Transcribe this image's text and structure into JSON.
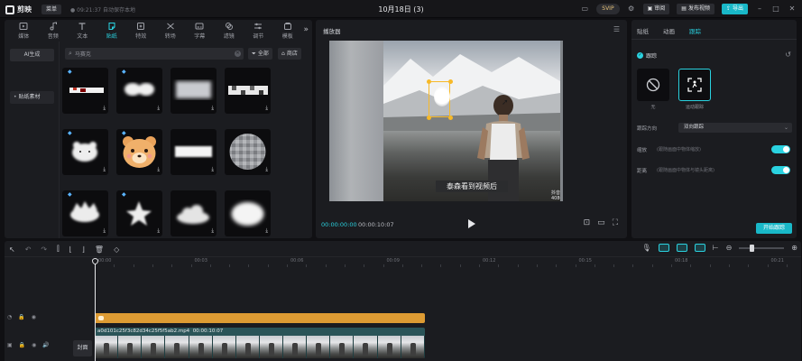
{
  "app": {
    "name": "剪映",
    "menu_label": "菜单",
    "autosave": "● 09:21:37 自动保存本地",
    "doc_title": "10月18日 (3)",
    "svip": "SVIP",
    "shortcuts_label": "审阅",
    "publish_label": "发布视频",
    "export_label": "导出"
  },
  "toolbar": {
    "items": [
      {
        "label": "媒体",
        "icon": "media-icon"
      },
      {
        "label": "音频",
        "icon": "audio-icon"
      },
      {
        "label": "文本",
        "icon": "text-icon"
      },
      {
        "label": "贴纸",
        "icon": "sticker-icon",
        "active": true
      },
      {
        "label": "特效",
        "icon": "effects-icon"
      },
      {
        "label": "转场",
        "icon": "transition-icon"
      },
      {
        "label": "字幕",
        "icon": "subtitle-icon"
      },
      {
        "label": "滤镜",
        "icon": "filter-icon"
      },
      {
        "label": "调节",
        "icon": "adjust-icon"
      },
      {
        "label": "模板",
        "icon": "template-icon"
      }
    ]
  },
  "sidebar": {
    "ai_label": "AI生成",
    "selected_label": "贴纸素材"
  },
  "search": {
    "placeholder": "马赛克"
  },
  "chips": {
    "filter_label": "全部",
    "store_label": "商店"
  },
  "player": {
    "title": "播放器",
    "current_time": "00:00:00:00",
    "total_time": "00:00:10:07",
    "subtitle": "泰森看到视频后",
    "watermark": "抖音",
    "watermark_id": "抖音号: 40806235687"
  },
  "inspector": {
    "tabs": [
      "贴纸",
      "动画",
      "跟踪"
    ],
    "active_tab": 2,
    "track_label": "跟踪",
    "options": [
      {
        "label": "无",
        "icon": "none-icon"
      },
      {
        "label": "运动跟踪",
        "icon": "motion-track-icon",
        "selected": true
      }
    ],
    "direction_label": "跟踪方向",
    "direction_value": "双向跟踪",
    "scale_label": "缩放",
    "scale_desc": "(跟随画面中物体缩放)",
    "distance_label": "距离",
    "distance_desc": "(跟随画面中物体与镜头距离)",
    "start_label": "开始跟踪"
  },
  "timeline": {
    "ticks": [
      "00:00",
      "00:03",
      "00:06",
      "00:09",
      "00:12",
      "00:15",
      "00:18",
      "00:21"
    ],
    "cover_label": "封面",
    "clip_name": "a0d101c25f3c82d34c25f5f5ab2.mp4",
    "clip_duration": "00:00:10:07"
  },
  "colors": {
    "accent": "#2ad2e0",
    "sticker_clip": "#dd9b33",
    "video_clip": "#2a5458",
    "track_box": "#f7b928"
  }
}
